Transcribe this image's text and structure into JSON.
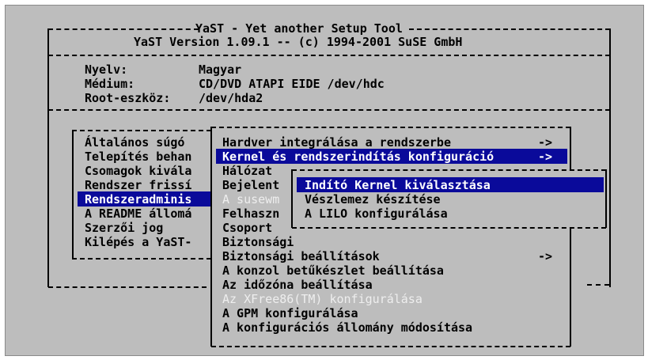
{
  "header": {
    "title": "YaST - Yet another Setup Tool",
    "version": "YaST Version 1.09.1 -- (c) 1994-2001 SuSE GmbH"
  },
  "info": {
    "language_label": "Nyelv:",
    "language_value": "Magyar",
    "medium_label": "Médium:",
    "medium_value": "CD/DVD ATAPI EIDE /dev/hdc",
    "root_label": "Root-eszköz:",
    "root_value": "/dev/hda2"
  },
  "main_menu": {
    "items": [
      {
        "label": "Általános súgó"
      },
      {
        "label": "Telepítés behan"
      },
      {
        "label": "Csomagok kivála"
      },
      {
        "label": "Rendszer frissí"
      },
      {
        "label": "Rendszeradminis"
      },
      {
        "label": "A README állomá"
      },
      {
        "label": "Szerzői jog"
      },
      {
        "label": "Kilépés a YaST-"
      }
    ]
  },
  "admin_menu": {
    "items": [
      {
        "label": "Hardver integrálása a rendszerbe",
        "arrow": "->"
      },
      {
        "label": "Kernel és rendszerindítás konfiguráció",
        "arrow": "->"
      },
      {
        "label": "Hálózat"
      },
      {
        "label": "Bejelent"
      },
      {
        "label": "A susewm"
      },
      {
        "label": "Felhaszn"
      },
      {
        "label": "Csoport"
      },
      {
        "label": "Biztonsági"
      },
      {
        "label": "Biztonsági beállítások",
        "arrow": "->"
      },
      {
        "label": "A konzol betűkészlet beállítása"
      },
      {
        "label": "Az időzóna beállítása"
      },
      {
        "label": "Az XFree86(TM) konfigurálása"
      },
      {
        "label": "A GPM konfigurálása"
      },
      {
        "label": "A konfigurációs állomány módosítása"
      }
    ]
  },
  "kernel_menu": {
    "items": [
      {
        "label": "Indító Kernel kiválasztása"
      },
      {
        "label": "Vészlemez készítése"
      },
      {
        "label": "A LILO konfigurálása"
      }
    ]
  },
  "colors": {
    "background": "#bdbdbd",
    "highlight": "#0a0a9a",
    "highlight_text": "#ffffff",
    "disabled_text": "#eeeeee"
  }
}
